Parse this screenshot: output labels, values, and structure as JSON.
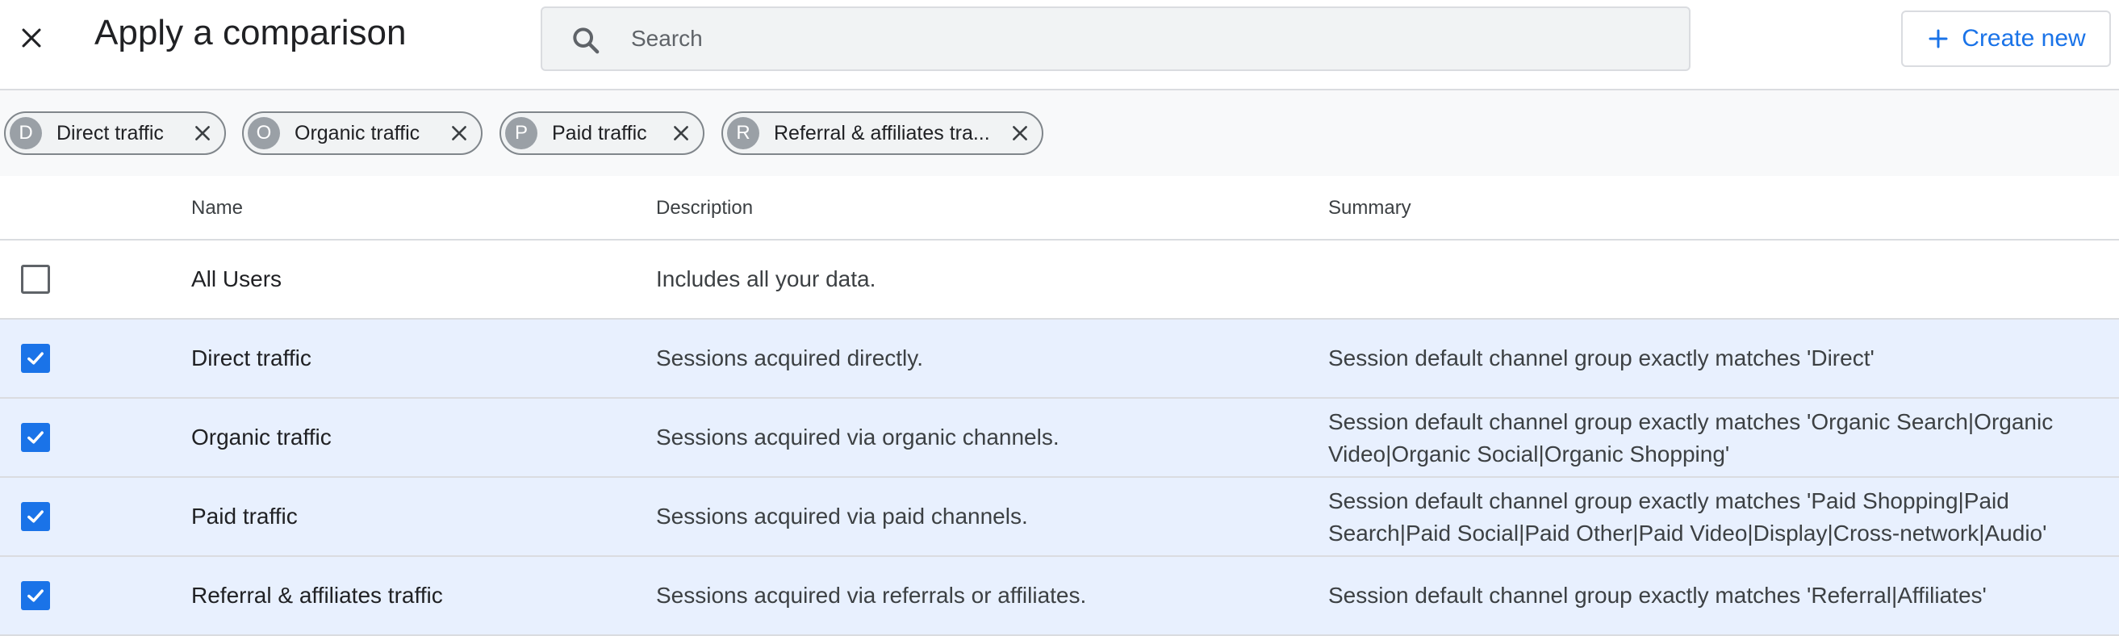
{
  "header": {
    "title": "Apply a comparison",
    "search_placeholder": "Search",
    "create_label": "Create new"
  },
  "chips": [
    {
      "initial": "D",
      "label": "Direct traffic"
    },
    {
      "initial": "O",
      "label": "Organic traffic"
    },
    {
      "initial": "P",
      "label": "Paid traffic"
    },
    {
      "initial": "R",
      "label": "Referral & affiliates tra..."
    }
  ],
  "table": {
    "columns": [
      "Name",
      "Description",
      "Summary"
    ],
    "rows": [
      {
        "checked": false,
        "name": "All Users",
        "description": "Includes all your data.",
        "summary": ""
      },
      {
        "checked": true,
        "name": "Direct traffic",
        "description": "Sessions acquired directly.",
        "summary": "Session default channel group exactly matches 'Direct'"
      },
      {
        "checked": true,
        "name": "Organic traffic",
        "description": "Sessions acquired via organic channels.",
        "summary": "Session default channel group exactly matches 'Organic Search|Organic Video|Organic Social|Organic Shopping'"
      },
      {
        "checked": true,
        "name": "Paid traffic",
        "description": "Sessions acquired via paid channels.",
        "summary": "Session default channel group exactly matches 'Paid Shopping|Paid Search|Paid Social|Paid Other|Paid Video|Display|Cross-network|Audio'"
      },
      {
        "checked": true,
        "name": "Referral & affiliates traffic",
        "description": "Sessions acquired via referrals or affiliates.",
        "summary": "Session default channel group exactly matches 'Referral|Affiliates'"
      }
    ]
  },
  "icons": {
    "close": "close-icon",
    "search": "search-icon",
    "add": "plus-icon",
    "chip_remove": "close-icon",
    "checkbox": "check-icon"
  },
  "colors": {
    "accent": "#1a73e8",
    "selected_row": "#e8f0fe",
    "chip_avatar": "#9aa0a6"
  }
}
